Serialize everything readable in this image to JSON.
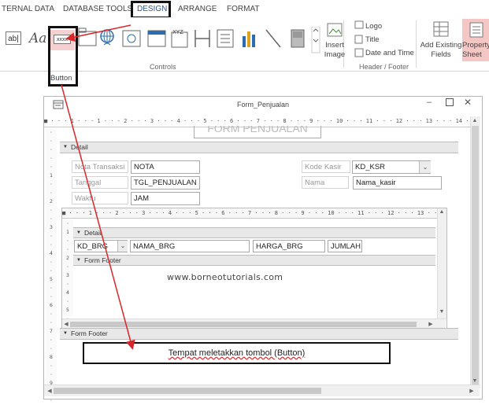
{
  "ribbon": {
    "tabs": [
      "TERNAL DATA",
      "DATABASE TOOLS",
      "DESIGN",
      "ARRANGE",
      "FORMAT"
    ],
    "controls_group_label": "Controls",
    "header_footer_group_label": "Header / Footer",
    "button_tooltip": "Button",
    "textbox_icon": "ab|",
    "label_icon": "Aa",
    "button_icon_text": "xxxx",
    "insert_image_label": "Insert Image",
    "logo_label": "Logo",
    "title_label": "Title",
    "date_time_label": "Date and Time",
    "add_fields_label": "Add Existing Fields",
    "property_sheet_label": "Property Sheet"
  },
  "window": {
    "title": "Form_Penjualan",
    "form_header_text": "FORM PENJUALAN",
    "detail_section": "Detail",
    "form_footer_section": "Form Footer",
    "fields": {
      "nota_label": "Nota Transaksi",
      "nota_value": "NOTA",
      "kode_kasir_label": "Kode Kasir",
      "kode_kasir_value": "KD_KSR",
      "tanggal_label": "Tanggal",
      "tanggal_value": "TGL_PENJUALAN",
      "nama_label": "Nama",
      "nama_value": "Nama_kasir",
      "waktu_label": "Waktu",
      "waktu_value": "JAM"
    },
    "subform": {
      "detail_label": "Detail",
      "footer_label": "Form Footer",
      "fields": [
        "KD_BRG",
        "NAMA_BRG",
        "HARGA_BRG",
        "JUMLAH"
      ],
      "watermark": "www.borneotutorials.com"
    },
    "footer_note": "Tempat meletakkan tombol (Button)"
  },
  "colors": {
    "highlight_box": "#111111",
    "arrow": "#d9262b",
    "property_sheet_bg": "#f4c7c5"
  }
}
